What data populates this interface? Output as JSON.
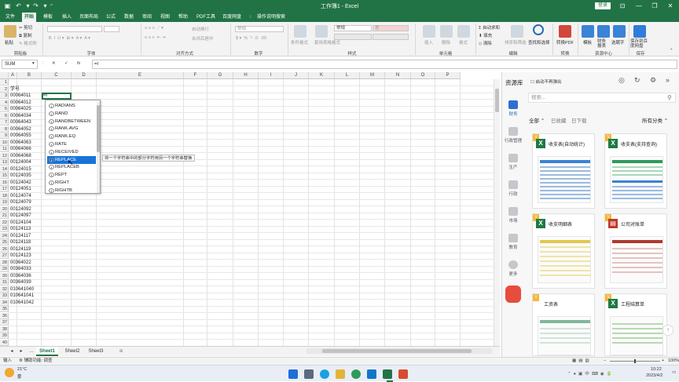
{
  "title_bar": {
    "title": "工作簿1 - Excel",
    "login": "登录"
  },
  "menu": [
    "文件",
    "开始",
    "模板",
    "插入",
    "页面布局",
    "公式",
    "数据",
    "审阅",
    "视图",
    "帮助",
    "PDF工具",
    "百度网盘",
    "操作说明搜索"
  ],
  "ribbon": {
    "paste": "粘贴",
    "cut": "剪切",
    "copy": "复制",
    "format_painter": "格式刷",
    "groups": [
      "剪贴板",
      "字体",
      "对齐方式",
      "数字",
      "样式",
      "单元格",
      "编辑",
      "转换",
      "资源中心",
      "保存"
    ],
    "wrap": "自动换行",
    "merge": "合并后居中",
    "number_format": "常规",
    "style_normal": "常规",
    "style_bad": "差",
    "conditional": "条件格式",
    "table_format": "套用表格格式",
    "insert": "插入",
    "delete": "删除",
    "format": "格式",
    "autosum": "自动求和",
    "fill": "填充",
    "clear": "清除",
    "sort_filter": "排序和筛选",
    "find_select": "查找和选择",
    "to_pdf": "转换PDF",
    "template": "模板",
    "finance": "财务报表",
    "recruit": "选聘字",
    "save_baidu": "保存到百度网盘"
  },
  "formula_bar": {
    "name_box": "SUM",
    "cancel": "✕",
    "enter": "✓",
    "fx": "fx",
    "value": "=r"
  },
  "columns": [
    "A",
    "B",
    "C",
    "D",
    "E",
    "F",
    "G",
    "H",
    "I",
    "J",
    "K",
    "L",
    "M",
    "N",
    "O",
    "P"
  ],
  "rows": [
    {
      "n": "1",
      "b": ""
    },
    {
      "n": "2",
      "b": "学号"
    },
    {
      "n": "3",
      "b": "00064011",
      "c": "=r"
    },
    {
      "n": "4",
      "b": "00064012"
    },
    {
      "n": "5",
      "b": "00064025"
    },
    {
      "n": "6",
      "b": "00064034"
    },
    {
      "n": "7",
      "b": "00064043"
    },
    {
      "n": "8",
      "b": "00064052"
    },
    {
      "n": "9",
      "b": "00064055"
    },
    {
      "n": "10",
      "b": "00064063"
    },
    {
      "n": "11",
      "b": "00064066"
    },
    {
      "n": "12",
      "b": "00064068"
    },
    {
      "n": "13",
      "b": "00124004"
    },
    {
      "n": "14",
      "b": "00124015"
    },
    {
      "n": "15",
      "b": "00124035"
    },
    {
      "n": "16",
      "b": "00124042"
    },
    {
      "n": "17",
      "b": "00124051"
    },
    {
      "n": "18",
      "b": "00124074"
    },
    {
      "n": "19",
      "b": "00124079"
    },
    {
      "n": "20",
      "b": "00124092"
    },
    {
      "n": "21",
      "b": "00124097"
    },
    {
      "n": "22",
      "b": "00124104"
    },
    {
      "n": "23",
      "b": "00124113"
    },
    {
      "n": "24",
      "b": "00124117"
    },
    {
      "n": "25",
      "b": "00124118"
    },
    {
      "n": "26",
      "b": "00124119"
    },
    {
      "n": "27",
      "b": "00124123"
    },
    {
      "n": "28",
      "b": "00364022"
    },
    {
      "n": "29",
      "b": "00364033"
    },
    {
      "n": "30",
      "b": "00364036"
    },
    {
      "n": "31",
      "b": "00364039"
    },
    {
      "n": "32",
      "b": "010641040"
    },
    {
      "n": "33",
      "b": "010641041"
    },
    {
      "n": "34",
      "b": "010641042"
    },
    {
      "n": "35",
      "b": ""
    },
    {
      "n": "36",
      "b": ""
    },
    {
      "n": "37",
      "b": ""
    },
    {
      "n": "38",
      "b": ""
    },
    {
      "n": "39",
      "b": ""
    },
    {
      "n": "40",
      "b": ""
    }
  ],
  "autocomplete": [
    "RADIANS",
    "RAND",
    "RANDBETWEEN",
    "RANK.AVG",
    "RANK.EQ",
    "RATE",
    "RECEIVED",
    "REPLACE",
    "REPLACEB",
    "REPT",
    "RIGHT",
    "RIGHTB"
  ],
  "autocomplete_selected": 7,
  "tooltip": "将一个字符串中的部分字符用另一个字符串替换",
  "sheets": [
    "Sheet1",
    "Sheet2",
    "Sheet3"
  ],
  "panel": {
    "title": "资源库",
    "no_popup": "启动不再弹出",
    "search_placeholder": "搜索...",
    "filters": [
      "全部",
      "已收藏",
      "日下载"
    ],
    "all_categories": "所有分类",
    "nav": [
      "财务",
      "行政管理",
      "生产",
      "行政",
      "市场",
      "教育",
      "更多"
    ],
    "cards": [
      "收支表(自动统计)",
      "收支表(支持查询)",
      "收支明细表",
      "公司对账单",
      "工资表",
      "工程结算单"
    ]
  },
  "status": {
    "mode": "输入",
    "accessibility": "辅助功能: 调查",
    "zoom": "100%"
  },
  "taskbar": {
    "weather_temp": "21°C",
    "weather_desc": "雾",
    "time": "10:22",
    "date": "2023/4/2"
  }
}
